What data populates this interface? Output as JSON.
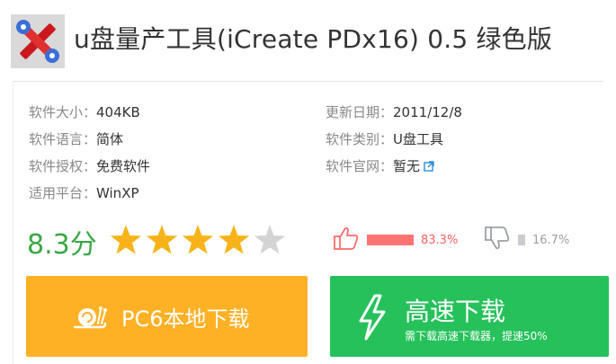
{
  "title": "u盘量产工具(iCreate PDx16) 0.5 绿色版",
  "info": {
    "size_label": "软件大小：",
    "size_value": "404KB",
    "language_label": "软件语言：",
    "language_value": "简体",
    "license_label": "软件授权：",
    "license_value": "免费软件",
    "platform_label": "适用平台：",
    "platform_value": "WinXP",
    "updated_label": "更新日期：",
    "updated_value": "2011/12/8",
    "category_label": "软件类别：",
    "category_value": "U盘工具",
    "website_label": "软件官网：",
    "website_value": "暂无"
  },
  "rating": {
    "score": "8.3分",
    "stars_filled": 4,
    "stars_total": 5
  },
  "votes": {
    "like_pct": "83.3%",
    "dislike_pct": "16.7%",
    "like_fraction": 0.833,
    "dislike_fraction": 0.167
  },
  "buttons": {
    "local_label": "PC6本地下载",
    "fast_label": "高速下载",
    "fast_sub": "需下载高速下载器，提速50%"
  },
  "colors": {
    "score_green": "#3aa845",
    "star_filled": "#f7b319",
    "star_empty": "#d4d4d4",
    "like": "#ff7373",
    "dislike": "#c9ccd1",
    "local_button": "#ffb126",
    "fast_button": "#26c15b",
    "link_icon": "#2e8ddc"
  },
  "icons": {
    "app": "tools-cross-icon",
    "external": "external-link-icon",
    "like": "thumbs-up-icon",
    "dislike": "thumbs-down-icon",
    "snail": "snail-icon",
    "lightning": "lightning-icon",
    "star": "star-icon"
  }
}
